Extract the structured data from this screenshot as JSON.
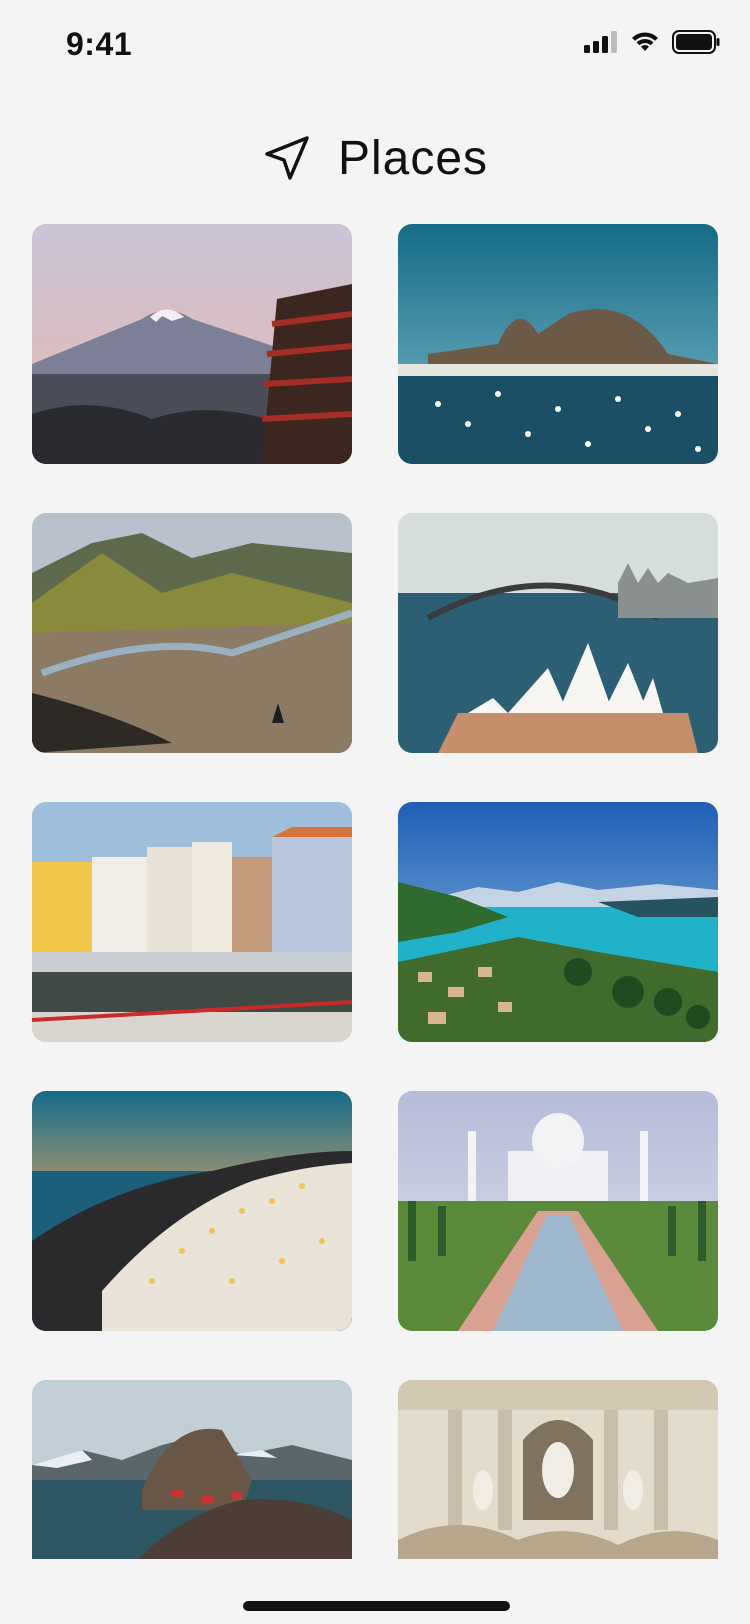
{
  "status": {
    "time": "9:41"
  },
  "header": {
    "title": "Places",
    "icon": "navigation-arrow-icon"
  },
  "places": [
    {
      "id": "fuji-pagoda",
      "sky": [
        "#cfc7d6",
        "#e6b9b4"
      ]
    },
    {
      "id": "rio-sugarloaf",
      "sky": [
        "#1f6e86",
        "#6fb3c6"
      ]
    },
    {
      "id": "iceland-valley",
      "sky": [
        "#9aa9bd",
        "#c4c8cf"
      ]
    },
    {
      "id": "sydney-opera-house",
      "sky": [
        "#c9d3d6",
        "#dfe5e3"
      ]
    },
    {
      "id": "aveiro-canal",
      "sky": [
        "#8fb0cf",
        "#c9d8e4"
      ]
    },
    {
      "id": "swiss-lake",
      "sky": [
        "#2b6fbf",
        "#8bbbe0"
      ]
    },
    {
      "id": "santorini-night",
      "sky": [
        "#1d6b87",
        "#d8a066"
      ]
    },
    {
      "id": "taj-mahal",
      "sky": [
        "#b8bfd6",
        "#dcdfe9"
      ]
    },
    {
      "id": "lofoten-islands",
      "sky": [
        "#b6c4cc",
        "#d9dfe2"
      ]
    },
    {
      "id": "trevi-fountain",
      "sky": [
        "#d6cdbd",
        "#ebe3d4"
      ]
    }
  ]
}
